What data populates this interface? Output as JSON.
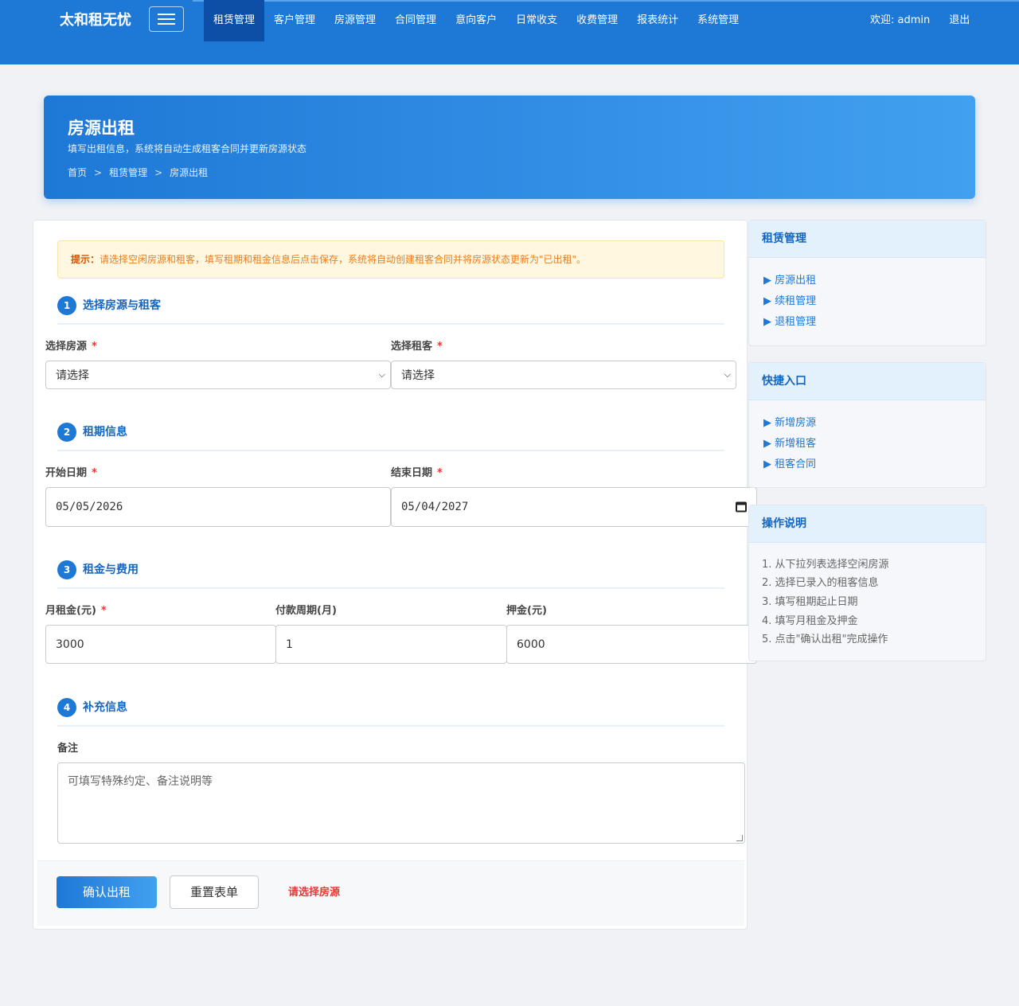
{
  "nav": {
    "brand": "太和租无忧",
    "items": [
      {
        "label": "租赁管理",
        "active": true
      },
      {
        "label": "客户管理"
      },
      {
        "label": "房源管理"
      },
      {
        "label": "合同管理"
      },
      {
        "label": "意向客户"
      },
      {
        "label": "日常收支"
      },
      {
        "label": "收费管理"
      },
      {
        "label": "报表统计"
      },
      {
        "label": "系统管理"
      }
    ],
    "welcome": "欢迎: admin",
    "logout": "退出"
  },
  "banner": {
    "title": "房源出租",
    "subtitle": "填写出租信息，系统将自动生成租客合同并更新房源状态",
    "breadcrumb": [
      "首页",
      "租赁管理",
      "房源出租"
    ],
    "separator": ">"
  },
  "tip": {
    "label": "提示：",
    "text": "请选择空闲房源和租客，填写租期和租金信息后点击保存，系统将自动创建租客合同并将房源状态更新为\"已出租\"。"
  },
  "sections": [
    {
      "num": "1",
      "title": "选择房源与租客"
    },
    {
      "num": "2",
      "title": "租期信息"
    },
    {
      "num": "3",
      "title": "租金与费用"
    },
    {
      "num": "4",
      "title": "补充信息"
    }
  ],
  "form": {
    "required_mark": "*",
    "house": {
      "label": "选择房源",
      "value": "请选择"
    },
    "tenant": {
      "label": "选择租客",
      "value": "请选择"
    },
    "start_date": {
      "label": "开始日期",
      "value": "05/05/2026"
    },
    "end_date": {
      "label": "结束日期",
      "value": "05/04/2027"
    },
    "rent": {
      "label": "月租金(元)",
      "value": "3000"
    },
    "pay_cycle": {
      "label": "付款周期(月)",
      "value": "1"
    },
    "deposit": {
      "label": "押金(元)",
      "value": "6000"
    },
    "remark": {
      "label": "备注",
      "placeholder": "可填写特殊约定、备注说明等"
    }
  },
  "actions": {
    "confirm": "确认出租",
    "reset": "重置表单",
    "error": "请选择房源"
  },
  "side": {
    "rental": {
      "title": "租赁管理",
      "links": [
        "▶ 房源出租",
        "▶ 续租管理",
        "▶ 退租管理"
      ]
    },
    "quick": {
      "title": "快捷入口",
      "links": [
        "▶ 新增房源",
        "▶ 新增租客",
        "▶ 租客合同"
      ]
    },
    "guide": {
      "title": "操作说明",
      "steps": [
        "1. 从下拉列表选择空闲房源",
        "2. 选择已录入的租客信息",
        "3. 填写租期起止日期",
        "4. 填写月租金及押金",
        "5. 点击\"确认出租\"完成操作"
      ]
    }
  }
}
